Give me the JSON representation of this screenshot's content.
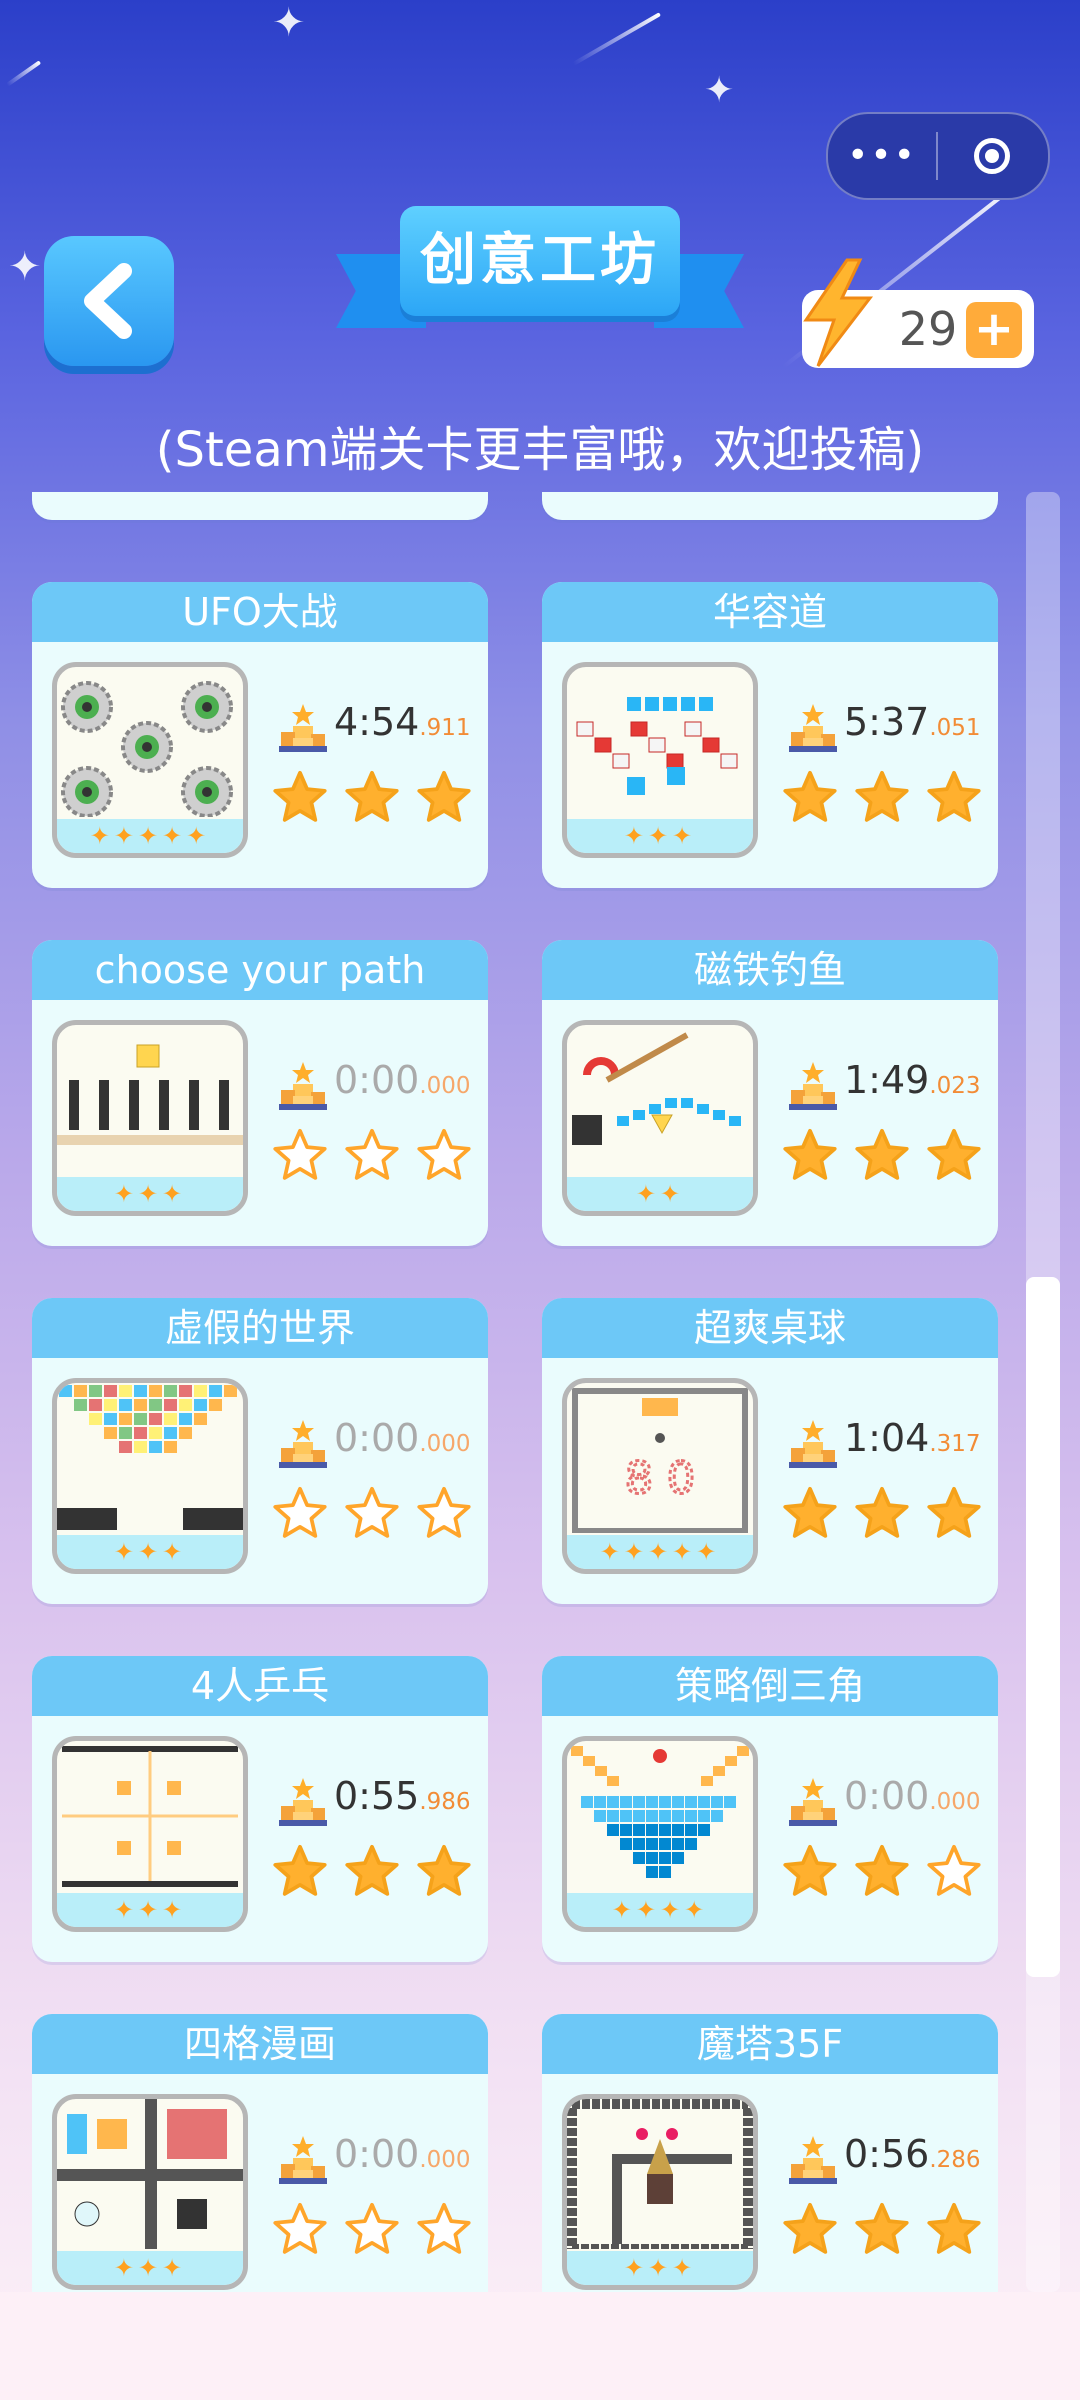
{
  "header": {
    "title": "创意工坊",
    "subtitle": "(Steam端关卡更丰富哦，欢迎投稿)",
    "energy": "29",
    "plus": "+",
    "more_menu": "•••"
  },
  "colors": {
    "accent": "#2ca6f6",
    "star_fill": "#ffb02e",
    "header_strip": "#6dc8f7",
    "ms_text": "#f28c36"
  },
  "levels": [
    {
      "title": "UFO大战",
      "time_main": "4:54",
      "time_ms": ".911",
      "stars": 3,
      "thumb_stars": "✦✦✦✦✦",
      "thumb": "ufo"
    },
    {
      "title": "华容道",
      "time_main": "5:37",
      "time_ms": ".051",
      "stars": 3,
      "thumb_stars": "✦✦✦",
      "thumb": "arrows"
    },
    {
      "title": "choose your path",
      "time_main": "0:00",
      "time_ms": ".000",
      "stars": 0,
      "thumb_stars": "✦✦✦",
      "thumb": "path"
    },
    {
      "title": "磁铁钓鱼",
      "time_main": "1:49",
      "time_ms": ".023",
      "stars": 3,
      "thumb_stars": "✦✦",
      "thumb": "magnet"
    },
    {
      "title": "虚假的世界",
      "time_main": "0:00",
      "time_ms": ".000",
      "stars": 0,
      "thumb_stars": "✦✦✦",
      "thumb": "blocks"
    },
    {
      "title": "超爽桌球",
      "time_main": "1:04",
      "time_ms": ".317",
      "stars": 3,
      "thumb_stars": "✦✦✦✦✦",
      "thumb": "pool"
    },
    {
      "title": "4人乒乓",
      "time_main": "0:55",
      "time_ms": ".986",
      "stars": 3,
      "thumb_stars": "✦✦✦",
      "thumb": "pong"
    },
    {
      "title": "策略倒三角",
      "time_main": "0:00",
      "time_ms": ".000",
      "stars": 2,
      "thumb_stars": "✦✦✦✦",
      "thumb": "triangle"
    },
    {
      "title": "四格漫画",
      "time_main": "0:00",
      "time_ms": ".000",
      "stars": 0,
      "thumb_stars": "✦✦✦",
      "thumb": "comic"
    },
    {
      "title": "魔塔35F",
      "time_main": "0:56",
      "time_ms": ".286",
      "stars": 3,
      "thumb_stars": "✦✦✦",
      "thumb": "tower"
    }
  ]
}
